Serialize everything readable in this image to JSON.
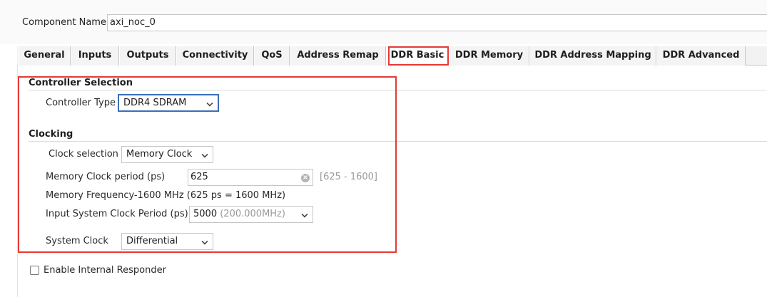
{
  "component": {
    "label": "Component Name",
    "value": "axi_noc_0"
  },
  "tabs": [
    {
      "label": "General"
    },
    {
      "label": "Inputs"
    },
    {
      "label": "Outputs"
    },
    {
      "label": "Connectivity"
    },
    {
      "label": "QoS"
    },
    {
      "label": "Address Remap"
    },
    {
      "label": "DDR Basic"
    },
    {
      "label": "DDR Memory"
    },
    {
      "label": "DDR Address Mapping"
    },
    {
      "label": "DDR Advanced"
    }
  ],
  "active_tab": "DDR Basic",
  "controller_selection": {
    "title": "Controller Selection",
    "controller_type_label": "Controller Type",
    "controller_type_value": "DDR4 SDRAM"
  },
  "clocking": {
    "title": "Clocking",
    "clock_selection_label": "Clock selection",
    "clock_selection_value": "Memory Clock",
    "mem_clock_period_label": "Memory Clock period (ps)",
    "mem_clock_period_value": "625",
    "mem_clock_period_range": "[625 - 1600]",
    "mem_frequency_text": "Memory Frequency-1600 MHz (625 ps = 1600 MHz)",
    "input_sys_clock_label": "Input System Clock Period (ps)",
    "input_sys_clock_value": "5000",
    "input_sys_clock_hint": "(200.000MHz)",
    "system_clock_label": "System Clock",
    "system_clock_value": "Differential"
  },
  "internal_responder": {
    "label": "Enable Internal Responder",
    "checked": false
  },
  "colors": {
    "highlight": "#e53935",
    "focus": "#3a6fb5"
  },
  "icons": [
    "chevron-down-icon",
    "clear-icon",
    "checkbox-icon"
  ]
}
